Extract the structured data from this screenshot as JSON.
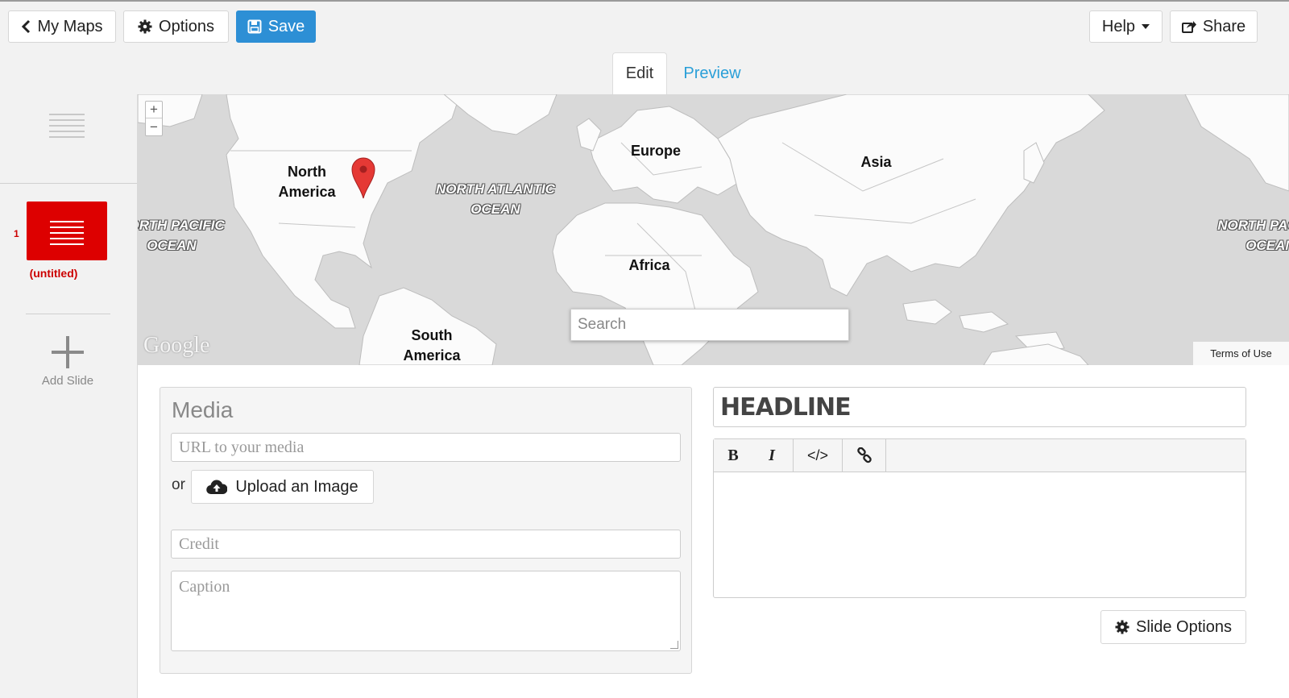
{
  "toolbar": {
    "my_maps_label": "My Maps",
    "options_label": "Options",
    "save_label": "Save",
    "help_label": "Help",
    "share_label": "Share"
  },
  "tabs": [
    {
      "label": "Edit",
      "active": true
    },
    {
      "label": "Preview",
      "active": false
    }
  ],
  "sidebar": {
    "slides": [
      {
        "number": "1",
        "label": "(untitled)",
        "selected": true
      }
    ],
    "add_slide_label": "Add Slide"
  },
  "map": {
    "zoom_in": "+",
    "zoom_out": "−",
    "search_placeholder": "Search",
    "attribution": "Google",
    "terms": "Terms of Use",
    "continent_labels": [
      "North America",
      "South America",
      "Europe",
      "Africa",
      "Asia"
    ],
    "ocean_labels": [
      "NORTH PACIFIC OCEAN",
      "NORTH ATLANTIC OCEAN"
    ],
    "marker_color": "#e53935"
  },
  "media": {
    "title": "Media",
    "url_placeholder": "URL to your media",
    "or_text": "or",
    "upload_label": "Upload an Image",
    "credit_placeholder": "Credit",
    "caption_placeholder": "Caption"
  },
  "text": {
    "headline_placeholder": "HEADLINE",
    "rte_buttons": [
      "B",
      "I",
      "</>",
      "link"
    ],
    "slide_options_label": "Slide Options"
  },
  "colors": {
    "accent": "#2d8fd5",
    "slide_red": "#dd0000",
    "tab_link": "#2a9fd8"
  }
}
